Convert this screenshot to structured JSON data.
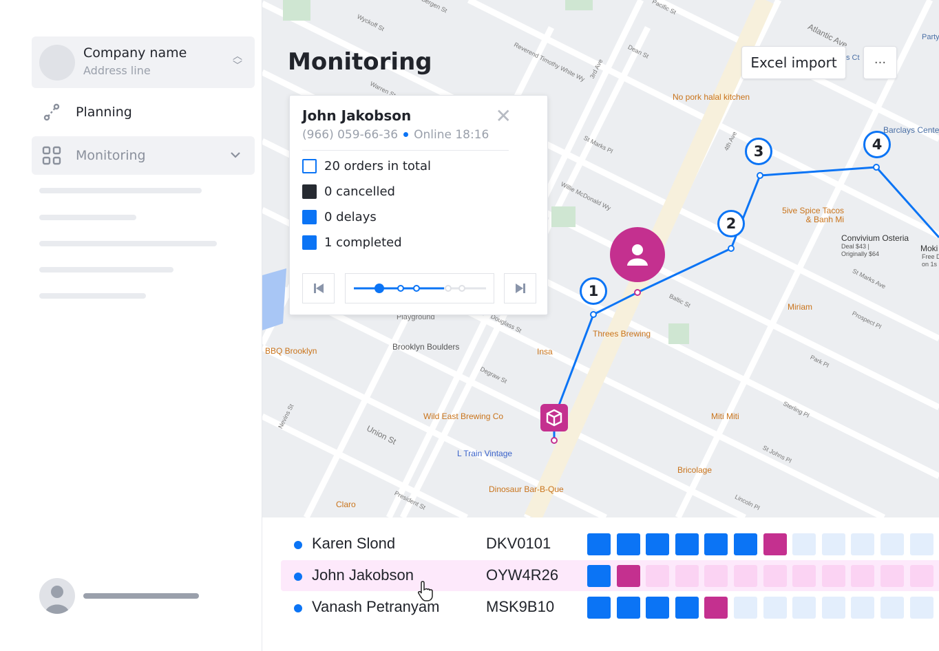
{
  "sidebar": {
    "company_name": "Company name",
    "address_line": "Address line",
    "items": [
      {
        "label": "Planning",
        "icon": "route-icon"
      },
      {
        "label": "Monitoring",
        "icon": "grid-icon"
      }
    ]
  },
  "header": {
    "title": "Monitoring",
    "excel_import": "Excel import",
    "more": "···"
  },
  "courier_card": {
    "name": "John Jakobson",
    "phone": "(966) 059-66-36",
    "status": "Online 18:16",
    "legend": [
      {
        "label": "20 orders in total",
        "style": "outline"
      },
      {
        "label": "0 cancelled",
        "color": "#262a31"
      },
      {
        "label": "0 delays",
        "color": "#0b74f5"
      },
      {
        "label": "1 completed",
        "color": "#0b74f5"
      }
    ],
    "timeline_position_step": 1,
    "timeline_steps": 5
  },
  "map": {
    "route_stops": [
      "1",
      "2",
      "3",
      "4"
    ],
    "streets": [
      "Wyckoff St",
      "Bergen St",
      "Reverend Timothy White Wy",
      "3rd Ave",
      "Dean St",
      "Pacific St",
      "Atlantic Ave",
      "Warren St",
      "St Marks Pl",
      "Willie McDonald Wy",
      "4th Ave",
      "Douglass St",
      "Baltic St",
      "Degraw St",
      "Union St",
      "Nevins St",
      "Sterling Pl",
      "St Johns Pl",
      "Lincoln Pl",
      "President St",
      "Park Pl",
      "Prospect Pl",
      "St Marks Ave",
      "Playground"
    ],
    "places": [
      "No pork halal kitchen",
      "Barclays Cente",
      "5ive Spice Tacos & Banh Mi",
      "Convivium Osteria",
      "Deal $43 | Originally $64",
      "Moki",
      "Free D on 1s",
      "Miriam",
      "Threes Brewing",
      "Insa",
      "Brooklyn Boulders",
      "BBQ Brooklyn",
      "Wild East Brewing Co",
      "L Train Vintage",
      "Miti Miti",
      "Bricolage",
      "Dinosaur Bar-B-Que",
      "Claro",
      "Party",
      "s Ct"
    ]
  },
  "couriers": [
    {
      "name": "Karen Slond",
      "code": "DKV0101",
      "done": 6,
      "current": 7,
      "selected": false
    },
    {
      "name": "John Jakobson",
      "code": "OYW4R26",
      "done": 1,
      "current": 2,
      "selected": true
    },
    {
      "name": "Vanash Petranyam",
      "code": "MSK9B10",
      "done": 4,
      "current": 5,
      "selected": false
    }
  ],
  "colors": {
    "accent": "#0b74f5",
    "magenta": "#c4308f",
    "pending_blue": "#e3eefc",
    "pending_pink": "#fbd3f3",
    "row_selected": "#fde9fb"
  }
}
